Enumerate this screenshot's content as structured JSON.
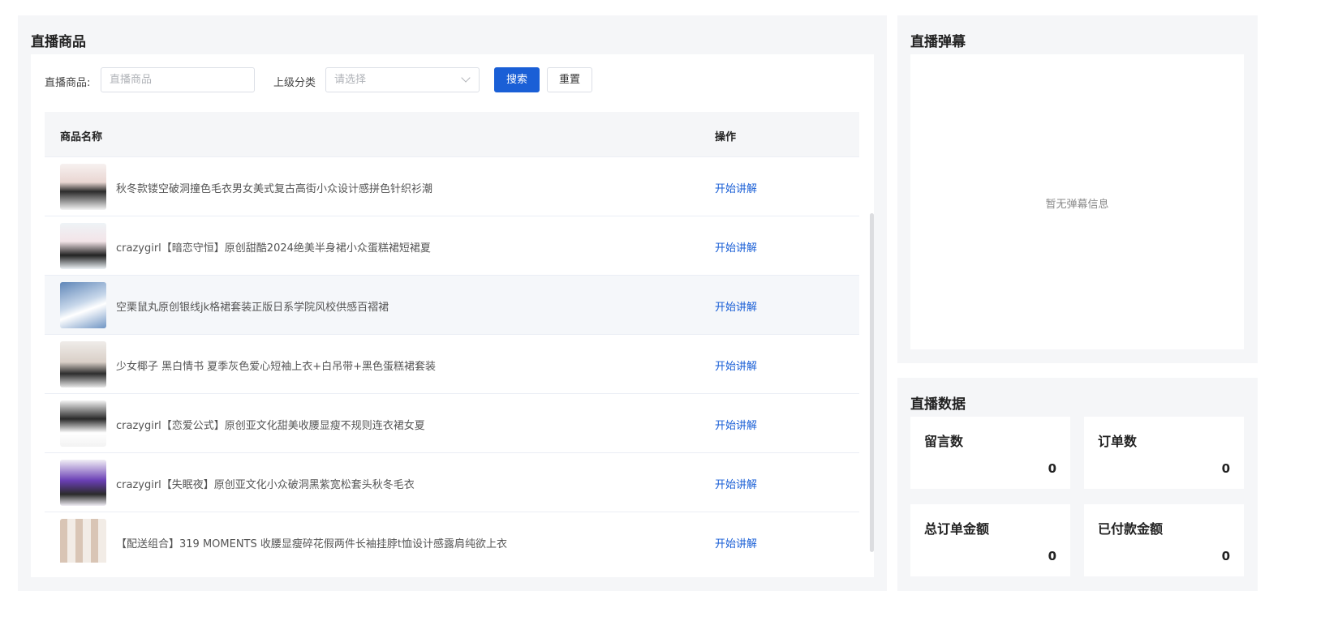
{
  "product_panel": {
    "title": "直播商品",
    "filter": {
      "product_label": "直播商品:",
      "product_placeholder": "直播商品",
      "category_label": "上级分类",
      "category_placeholder": "请选择",
      "search_button": "搜索",
      "reset_button": "重置"
    },
    "table": {
      "columns": [
        "商品名称",
        "操作"
      ],
      "rows": [
        {
          "name": "秋冬款镂空破洞撞色毛衣男女美式复古高街小众设计感拼色针织衫潮",
          "action": "开始讲解"
        },
        {
          "name": "crazygirl【暗恋守恒】原创甜酷2024绝美半身裙小众蛋糕裙短裙夏",
          "action": "开始讲解"
        },
        {
          "name": "空栗鼠丸原创银线jk格裙套装正版日系学院风校供感百褶裙",
          "action": "开始讲解"
        },
        {
          "name": "少女椰子 黑白情书 夏季灰色爱心短袖上衣+白吊带+黑色蛋糕裙套装",
          "action": "开始讲解"
        },
        {
          "name": "crazygirl【恋爱公式】原创亚文化甜美收腰显瘦不规则连衣裙女夏",
          "action": "开始讲解"
        },
        {
          "name": "crazygirl【失眠夜】原创亚文化小众破洞黑紫宽松套头秋冬毛衣",
          "action": "开始讲解"
        },
        {
          "name": "【配送组合】319 MOMENTS 收腰显瘦碎花假两件长袖挂脖t恤设计感露肩纯欲上衣",
          "action": "开始讲解"
        }
      ]
    }
  },
  "danmu_panel": {
    "title": "直播弹幕",
    "empty_text": "暂无弹幕信息"
  },
  "data_panel": {
    "title": "直播数据",
    "stats": [
      {
        "label": "留言数",
        "value": "0"
      },
      {
        "label": "订单数",
        "value": "0"
      },
      {
        "label": "总订单金额",
        "value": "0"
      },
      {
        "label": "已付款金额",
        "value": "0"
      }
    ]
  },
  "colors": {
    "primary": "#1a5fd6",
    "panel_bg": "#f5f6f8"
  }
}
